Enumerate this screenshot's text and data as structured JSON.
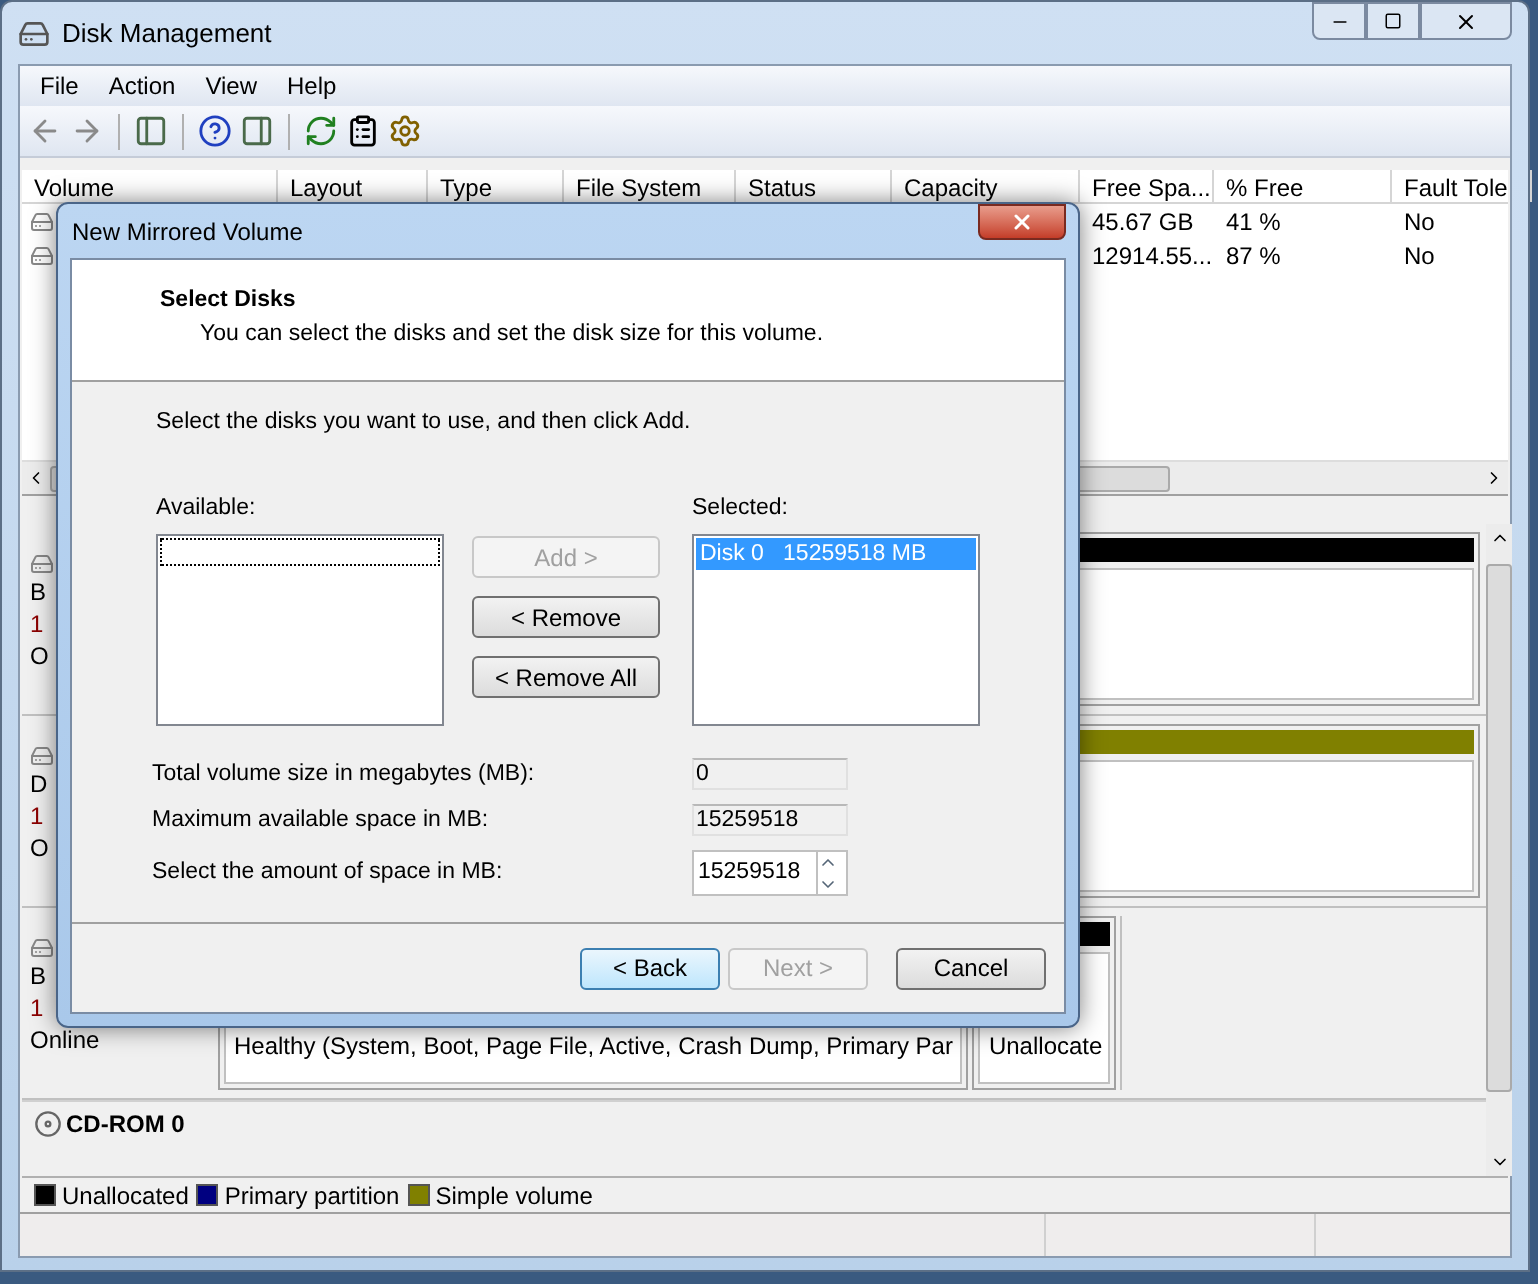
{
  "window": {
    "title": "Disk Management"
  },
  "menu": [
    "File",
    "Action",
    "View",
    "Help"
  ],
  "volume_list": {
    "columns": [
      "Volume",
      "Layout",
      "Type",
      "File System",
      "Status",
      "Capacity",
      "Free Spa...",
      "% Free",
      "Fault Tole"
    ],
    "rows": [
      {
        "free_space": "45.67 GB",
        "percent_free": "41 %",
        "fault_tolerance": "No"
      },
      {
        "free_space": "12914.55...",
        "percent_free": "87 %",
        "fault_tolerance": "No"
      }
    ]
  },
  "disks": [
    {
      "labels": [
        "B",
        "1",
        "O"
      ],
      "partitions": [
        {
          "kind": "unallocated"
        }
      ]
    },
    {
      "labels": [
        "D",
        "1",
        "O"
      ],
      "partitions": [
        {
          "kind": "simple"
        }
      ]
    },
    {
      "labels": [
        "B",
        "1",
        "Online"
      ],
      "partitions": [
        {
          "text": "Healthy (System, Boot, Page File, Active, Crash Dump, Primary Par"
        },
        {
          "kind": "unallocated",
          "text": "Unallocate"
        }
      ]
    },
    {
      "name": "CD-ROM 0"
    }
  ],
  "legend": [
    {
      "label": "Unallocated",
      "color": "#000000"
    },
    {
      "label": "Primary partition",
      "color": "#000080"
    },
    {
      "label": "Simple volume",
      "color": "#808000"
    }
  ],
  "dialog": {
    "title": "New Mirrored Volume",
    "heading": "Select Disks",
    "subheading": "You can select the disks and set the disk size for this volume.",
    "instruction": "Select the disks you want to use, and then click Add.",
    "available": {
      "label": "Available:"
    },
    "selected": {
      "label": "Selected:",
      "items": [
        {
          "text": "Disk 0   15259518 MB",
          "selected": true
        }
      ]
    },
    "move_buttons": [
      {
        "label": "Add >",
        "disabled": true
      },
      {
        "label": "< Remove",
        "disabled": false
      },
      {
        "label": "< Remove All",
        "disabled": false
      }
    ],
    "fields": [
      {
        "kind": "readonly",
        "label": "Total volume size in megabytes (MB):",
        "value": "0"
      },
      {
        "kind": "readonly",
        "label": "Maximum available space in MB:",
        "value": "15259518"
      },
      {
        "kind": "spinner",
        "label": "Select the amount of space in MB:",
        "value": "15259518"
      }
    ],
    "buttons": [
      {
        "label": "< Back",
        "disabled": false,
        "default": true
      },
      {
        "label": "Next >",
        "disabled": true,
        "default": false
      },
      {
        "label": "Cancel",
        "disabled": false,
        "default": false
      }
    ]
  }
}
